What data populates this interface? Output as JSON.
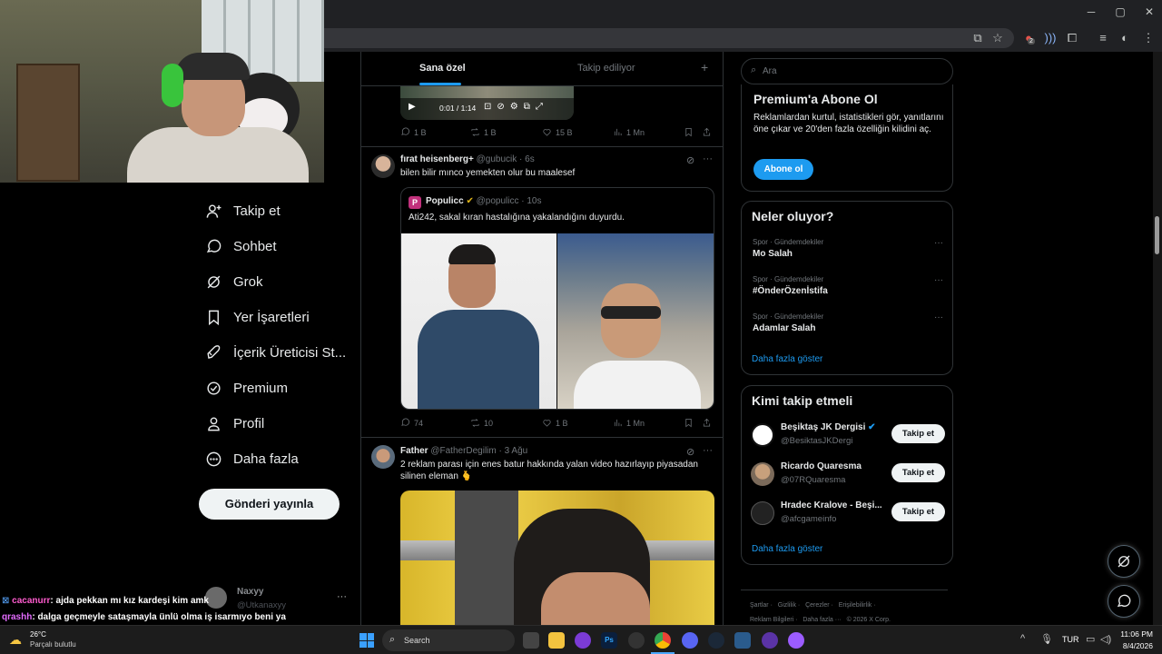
{
  "browser": {
    "icons": [
      "screen-share-icon",
      "star-icon",
      "extension-badge-icon",
      "audio-icon",
      "puzzle-icon",
      "media-icon",
      "profile-icon",
      "menu-icon"
    ],
    "badge_count": "2"
  },
  "window_controls": {
    "minimize": "─",
    "maximize": "▢",
    "close": "✕"
  },
  "left_nav": {
    "items": [
      {
        "label": "Takip et",
        "icon": "add-user-icon"
      },
      {
        "label": "Sohbet",
        "icon": "chat-icon"
      },
      {
        "label": "Grok",
        "icon": "grok-icon"
      },
      {
        "label": "Yer İşaretleri",
        "icon": "bookmark-icon"
      },
      {
        "label": "İçerik Üreticisi St...",
        "icon": "rocket-icon"
      },
      {
        "label": "Premium",
        "icon": "premium-icon"
      },
      {
        "label": "Profil",
        "icon": "person-icon"
      },
      {
        "label": "Daha fazla",
        "icon": "more-circle-icon"
      }
    ],
    "post_button": "Gönderi yayınla",
    "account": {
      "name": "Naxyy",
      "handle": "@Utkanaxyy",
      "more": "···"
    }
  },
  "chat": [
    {
      "user": "cacanurr",
      "text": ": ajda pekkan mı kız kardeşi kim amk",
      "color": "#ff5ccf"
    },
    {
      "user": "qrashh",
      "text": ": dalga geçmeyle sataşmayla ünlü olma iş isarmıyo beni ya",
      "color": "#e46cff"
    }
  ],
  "feed": {
    "tabs": [
      {
        "label": "Sana özel",
        "active": true
      },
      {
        "label": "Takip ediliyor",
        "active": false
      }
    ],
    "add_tab": "+",
    "video_controls": {
      "time": "0:01 / 1:14"
    },
    "tweet0_actions": {
      "replies": "1 B",
      "retweets": "1 B",
      "likes": "15 B",
      "views": "1 Mn"
    },
    "tweet1": {
      "name": "fırat heisenberg+",
      "handle": "@gubucik · 6s",
      "text": "bilen bilir mınco yemekten olur bu maalesef",
      "quote": {
        "name": "Populicc",
        "handle": "@populicc · 10s",
        "text": "Ati242, sakal kıran hastalığına yakalandığını duyurdu."
      },
      "actions": {
        "replies": "74",
        "retweets": "10",
        "likes": "1 B",
        "views": "1 Mn"
      }
    },
    "tweet2": {
      "name": "Father",
      "handle": "@FatherDegilim · 3 Ağu",
      "text": "2 reklam parası için enes batur hakkında yalan video hazırlayıp piyasadan silinen eleman 🫰"
    }
  },
  "sidebar": {
    "search_placeholder": "Ara",
    "premium": {
      "title": "Premium'a Abone Ol",
      "text": "Reklamlardan kurtul, istatistikleri gör, yanıtlarını öne çıkar ve 20'den fazla özelliğin kilidini aç.",
      "button": "Abone ol"
    },
    "trends_title": "Neler oluyor?",
    "trends": [
      {
        "category": "Spor · Gündemdekiler",
        "name": "Mo Salah"
      },
      {
        "category": "Spor · Gündemdekiler",
        "name": "#ÖnderÖzenİstifa"
      },
      {
        "category": "Spor · Gündemdekiler",
        "name": "Adamlar Salah"
      }
    ],
    "trends_more": "Daha fazla göster",
    "who_title": "Kimi takip etmeli",
    "who": [
      {
        "name": "Beşiktaş JK Dergisi",
        "handle": "@BesiktasJKDergi",
        "button": "Takip et"
      },
      {
        "name": "Ricardo Quaresma",
        "handle": "@07RQuaresma",
        "button": "Takip et"
      },
      {
        "name": "Hradec Kralove - Beşi...",
        "handle": "@afcgameinfo",
        "button": "Takip et"
      }
    ],
    "who_more": "Daha fazla göster",
    "footer": [
      "Şartlar",
      "Gizlilik",
      "Çerezler",
      "Erişilebilirlik",
      "Reklam Bilgileri",
      "Daha fazla ···",
      "© 2026 X Corp."
    ]
  },
  "taskbar": {
    "weather_temp": "26°C",
    "weather_desc": "Parçalı bulutlu",
    "search": "Search",
    "lang": "TUR",
    "time": "11:06 PM",
    "date": "8/4/2026"
  }
}
